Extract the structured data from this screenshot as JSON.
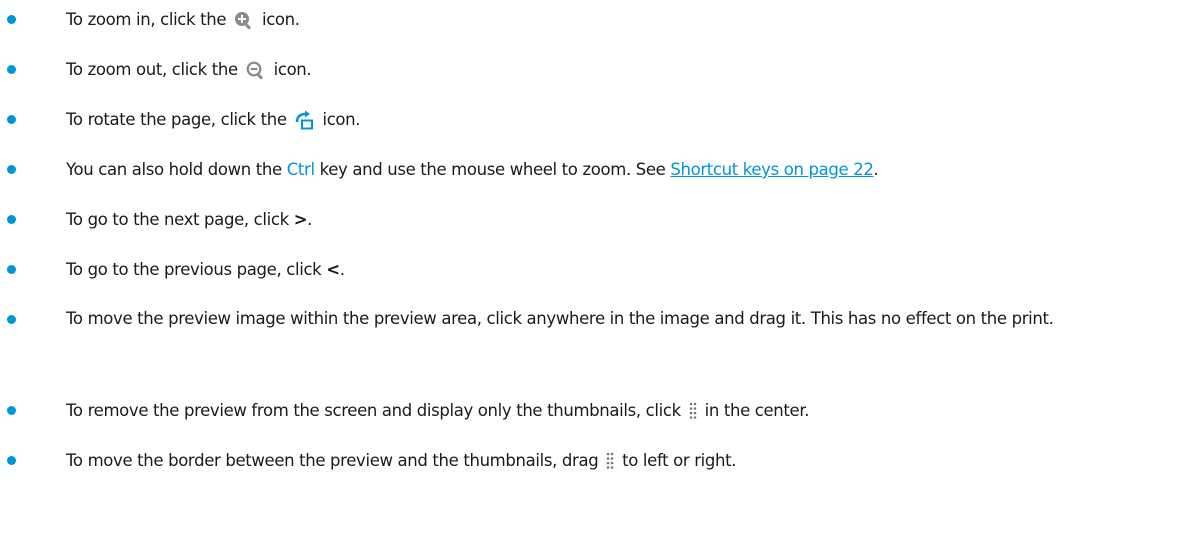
{
  "colors": {
    "accent": "#0096d6",
    "text": "#1a1a1a"
  },
  "items": [
    {
      "pre": "To zoom in, click the",
      "icon": "zoom-in-icon",
      "post": "icon."
    },
    {
      "pre": "To zoom out, click the",
      "icon": "zoom-out-icon",
      "post": "icon."
    },
    {
      "pre": "To rotate the page, click the",
      "icon": "rotate-icon",
      "post": "icon."
    },
    {
      "pre": "You can also hold down the",
      "key": "Ctrl",
      "mid": "key and use the mouse wheel to zoom. See",
      "link": "Shortcut keys on page 22",
      "post": "."
    },
    {
      "pre": "To go to the next page, click",
      "symbol": ">",
      "post": "."
    },
    {
      "pre": "To go to the previous page, click",
      "symbol": "<",
      "post": "."
    },
    {
      "text": "To move the preview image within the preview area, click anywhere in the image and drag it. This has no effect on the print."
    },
    {
      "pre": "To remove the preview from the screen and display only the thumbnails, click",
      "icon": "grip-handle-icon",
      "post": "in the center."
    },
    {
      "pre": "To move the border between the preview and the thumbnails, drag",
      "icon": "grip-handle-icon",
      "post": "to left or right."
    }
  ]
}
